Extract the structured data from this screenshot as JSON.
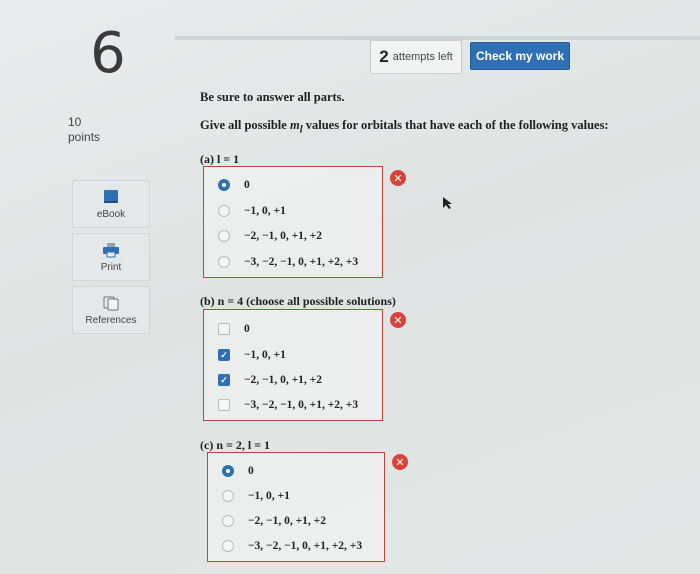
{
  "question": {
    "number": "6",
    "attempts_count": "2",
    "attempts_text": "attempts left",
    "check_button": "Check my work",
    "points_value": "10",
    "points_label": "points"
  },
  "sidebar": {
    "items": [
      {
        "label": "eBook",
        "icon": "book-icon"
      },
      {
        "label": "Print",
        "icon": "printer-icon"
      },
      {
        "label": "References",
        "icon": "references-icon"
      }
    ]
  },
  "content": {
    "instruction": "Be sure to answer all parts.",
    "prompt_before": "Give all possible ",
    "prompt_var": "m",
    "prompt_sub": "l",
    "prompt_after": " values for orbitals that have each of the following values:"
  },
  "parts": [
    {
      "label": "(a) l = 1",
      "type": "radio",
      "status": "incorrect",
      "options": [
        {
          "label": "0",
          "selected": true
        },
        {
          "label": "−1, 0, +1",
          "selected": false
        },
        {
          "label": "−2, −1, 0, +1, +2",
          "selected": false
        },
        {
          "label": "−3, −2, −1, 0, +1, +2, +3",
          "selected": false
        }
      ]
    },
    {
      "label": "(b) n = 4 (choose all possible solutions)",
      "type": "checkbox",
      "status": "incorrect",
      "options": [
        {
          "label": "0",
          "selected": false
        },
        {
          "label": "−1, 0, +1",
          "selected": true
        },
        {
          "label": "−2, −1, 0, +1, +2",
          "selected": true
        },
        {
          "label": "−3, −2, −1, 0, +1, +2, +3",
          "selected": false
        }
      ]
    },
    {
      "label": "(c) n = 2, l = 1",
      "type": "radio",
      "status": "incorrect",
      "options": [
        {
          "label": "0",
          "selected": true
        },
        {
          "label": "−1, 0, +1",
          "selected": false
        },
        {
          "label": "−2, −1, 0, +1, +2",
          "selected": false
        },
        {
          "label": "−3, −2, −1, 0, +1, +2, +3",
          "selected": false
        }
      ]
    }
  ],
  "colors": {
    "accent": "#2f6fb3",
    "error": "#d8433c",
    "box_border": "#c8403a"
  }
}
